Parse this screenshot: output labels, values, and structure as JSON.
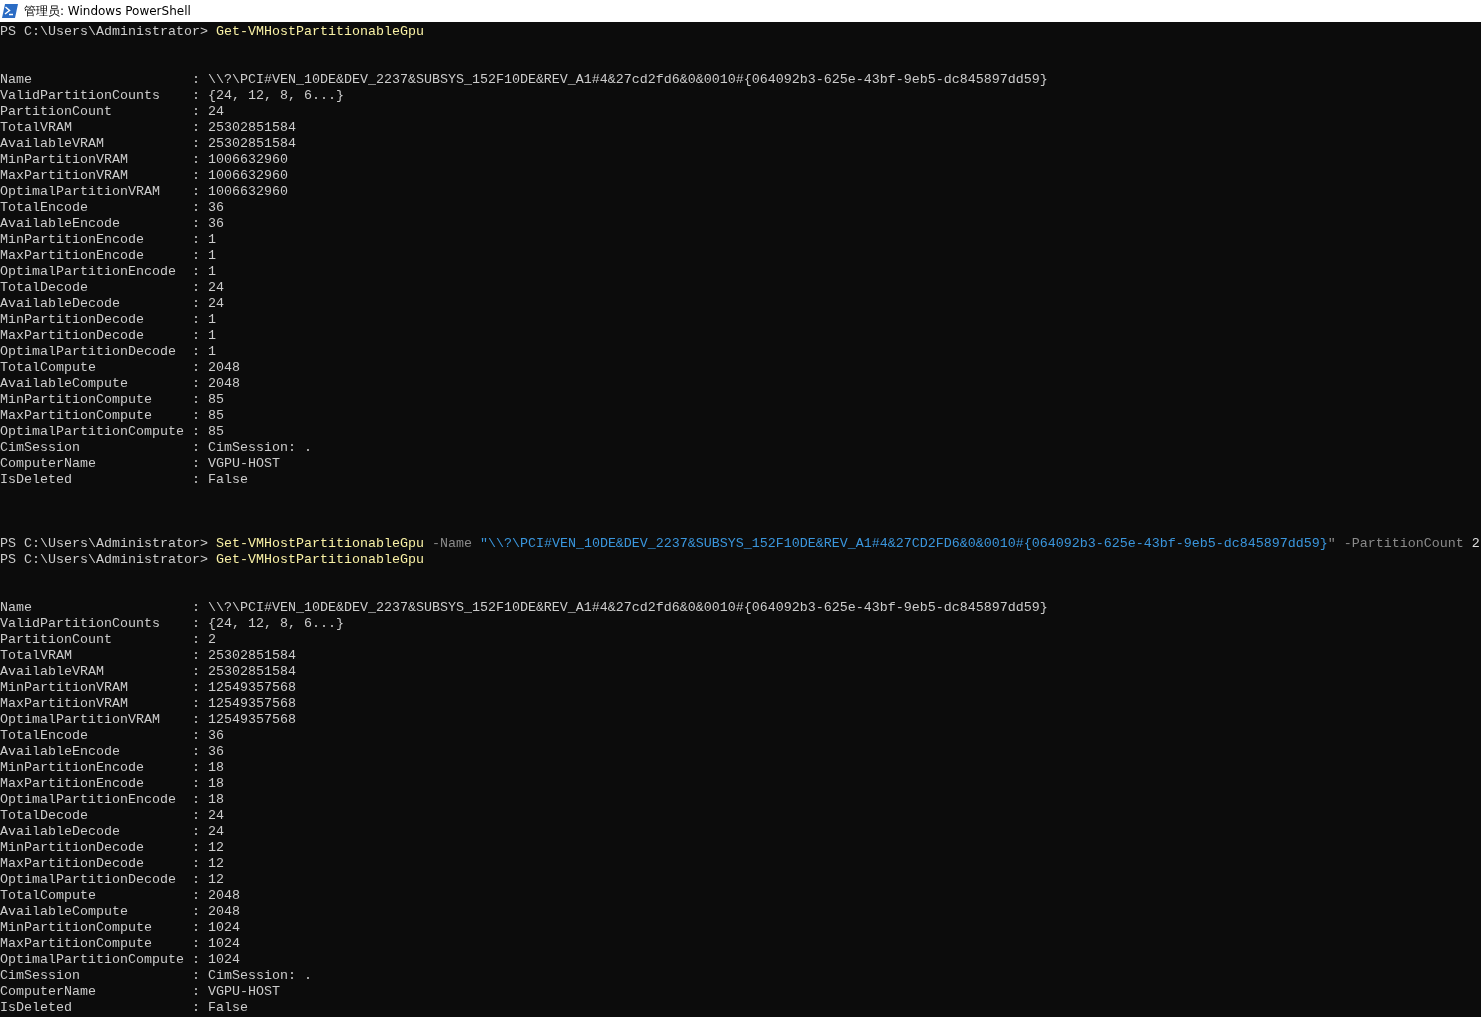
{
  "window": {
    "title": "管理员: Windows PowerShell"
  },
  "entries": [
    {
      "kind": "command",
      "prompt": "PS C:\\Users\\Administrator> ",
      "tokens": [
        {
          "kind": "cmdlet",
          "text": "Get-VMHostPartitionableGpu"
        }
      ]
    },
    {
      "kind": "output",
      "properties": [
        {
          "name": "Name",
          "value": ": \\\\?\\PCI#VEN_10DE&DEV_2237&SUBSYS_152F10DE&REV_A1#4&27cd2fd6&0&0010#{064092b3-625e-43bf-9eb5-dc845897dd59}"
        },
        {
          "name": "ValidPartitionCounts",
          "value": ": {24, 12, 8, 6...}"
        },
        {
          "name": "PartitionCount",
          "value": ": 24"
        },
        {
          "name": "TotalVRAM",
          "value": ": 25302851584"
        },
        {
          "name": "AvailableVRAM",
          "value": ": 25302851584"
        },
        {
          "name": "MinPartitionVRAM",
          "value": ": 1006632960"
        },
        {
          "name": "MaxPartitionVRAM",
          "value": ": 1006632960"
        },
        {
          "name": "OptimalPartitionVRAM",
          "value": ": 1006632960"
        },
        {
          "name": "TotalEncode",
          "value": ": 36"
        },
        {
          "name": "AvailableEncode",
          "value": ": 36"
        },
        {
          "name": "MinPartitionEncode",
          "value": ": 1"
        },
        {
          "name": "MaxPartitionEncode",
          "value": ": 1"
        },
        {
          "name": "OptimalPartitionEncode",
          "value": ": 1"
        },
        {
          "name": "TotalDecode",
          "value": ": 24"
        },
        {
          "name": "AvailableDecode",
          "value": ": 24"
        },
        {
          "name": "MinPartitionDecode",
          "value": ": 1"
        },
        {
          "name": "MaxPartitionDecode",
          "value": ": 1"
        },
        {
          "name": "OptimalPartitionDecode",
          "value": ": 1"
        },
        {
          "name": "TotalCompute",
          "value": ": 2048"
        },
        {
          "name": "AvailableCompute",
          "value": ": 2048"
        },
        {
          "name": "MinPartitionCompute",
          "value": ": 85"
        },
        {
          "name": "MaxPartitionCompute",
          "value": ": 85"
        },
        {
          "name": "OptimalPartitionCompute",
          "value": ": 85"
        },
        {
          "name": "CimSession",
          "value": ": CimSession: ."
        },
        {
          "name": "ComputerName",
          "value": ": VGPU-HOST"
        },
        {
          "name": "IsDeleted",
          "value": ": False"
        }
      ]
    },
    {
      "kind": "command",
      "prompt": "PS C:\\Users\\Administrator> ",
      "tokens": [
        {
          "kind": "cmdlet",
          "text": "Set-VMHostPartitionableGpu"
        },
        {
          "kind": "param",
          "text": " -Name"
        },
        {
          "kind": "string",
          "text": " \"\\\\?\\PCI#VEN_10DE&DEV_2237&SUBSYS_152F10DE&REV_A1#4&27CD2FD6&0&0010#{064092b3-625e-43bf-9eb5-dc845897dd59}"
        },
        {
          "kind": "param",
          "text": "\" -PartitionCount"
        },
        {
          "kind": "number",
          "text": " 2"
        }
      ]
    },
    {
      "kind": "command",
      "prompt": "PS C:\\Users\\Administrator> ",
      "tokens": [
        {
          "kind": "cmdlet",
          "text": "Get-VMHostPartitionableGpu"
        }
      ]
    },
    {
      "kind": "output",
      "properties": [
        {
          "name": "Name",
          "value": ": \\\\?\\PCI#VEN_10DE&DEV_2237&SUBSYS_152F10DE&REV_A1#4&27cd2fd6&0&0010#{064092b3-625e-43bf-9eb5-dc845897dd59}"
        },
        {
          "name": "ValidPartitionCounts",
          "value": ": {24, 12, 8, 6...}"
        },
        {
          "name": "PartitionCount",
          "value": ": 2"
        },
        {
          "name": "TotalVRAM",
          "value": ": 25302851584"
        },
        {
          "name": "AvailableVRAM",
          "value": ": 25302851584"
        },
        {
          "name": "MinPartitionVRAM",
          "value": ": 12549357568"
        },
        {
          "name": "MaxPartitionVRAM",
          "value": ": 12549357568"
        },
        {
          "name": "OptimalPartitionVRAM",
          "value": ": 12549357568"
        },
        {
          "name": "TotalEncode",
          "value": ": 36"
        },
        {
          "name": "AvailableEncode",
          "value": ": 36"
        },
        {
          "name": "MinPartitionEncode",
          "value": ": 18"
        },
        {
          "name": "MaxPartitionEncode",
          "value": ": 18"
        },
        {
          "name": "OptimalPartitionEncode",
          "value": ": 18"
        },
        {
          "name": "TotalDecode",
          "value": ": 24"
        },
        {
          "name": "AvailableDecode",
          "value": ": 24"
        },
        {
          "name": "MinPartitionDecode",
          "value": ": 12"
        },
        {
          "name": "MaxPartitionDecode",
          "value": ": 12"
        },
        {
          "name": "OptimalPartitionDecode",
          "value": ": 12"
        },
        {
          "name": "TotalCompute",
          "value": ": 2048"
        },
        {
          "name": "AvailableCompute",
          "value": ": 2048"
        },
        {
          "name": "MinPartitionCompute",
          "value": ": 1024"
        },
        {
          "name": "MaxPartitionCompute",
          "value": ": 1024"
        },
        {
          "name": "OptimalPartitionCompute",
          "value": ": 1024"
        },
        {
          "name": "CimSession",
          "value": ": CimSession: ."
        },
        {
          "name": "ComputerName",
          "value": ": VGPU-HOST"
        },
        {
          "name": "IsDeleted",
          "value": ": False"
        }
      ]
    }
  ]
}
